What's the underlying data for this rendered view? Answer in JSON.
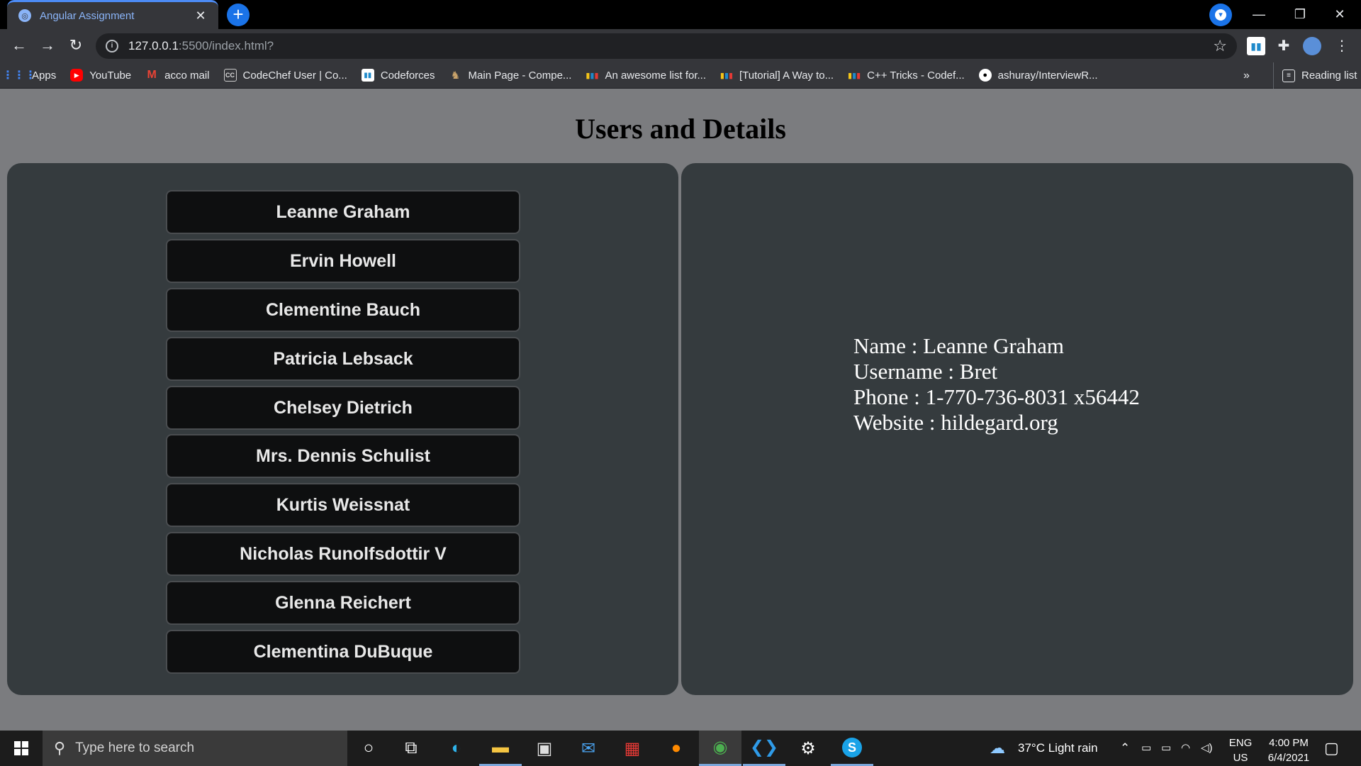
{
  "browser": {
    "tab_title": "Angular Assignment",
    "url_host": "127.0.0.1",
    "url_path": ":5500/index.html?",
    "bookmarks": [
      {
        "label": "Apps",
        "icon": "apps-grid-icon",
        "color": "#4285f4"
      },
      {
        "label": "YouTube",
        "icon": "youtube-icon",
        "color": "#ff0000"
      },
      {
        "label": "acco mail",
        "icon": "gmail-icon",
        "color": "#ea4335"
      },
      {
        "label": "CodeChef User | Co...",
        "icon": "codechef-icon",
        "color": "#ffffff"
      },
      {
        "label": "Codeforces",
        "icon": "codeforces-icon",
        "color": "#1f8acb"
      },
      {
        "label": "Main Page - Compe...",
        "icon": "wiki-icon",
        "color": "#c9a36b"
      },
      {
        "label": "An awesome list for...",
        "icon": "codeforces-icon",
        "color": "#1f8acb"
      },
      {
        "label": "[Tutorial] A Way to...",
        "icon": "codeforces-icon",
        "color": "#1f8acb"
      },
      {
        "label": "C++ Tricks - Codef...",
        "icon": "codeforces-icon",
        "color": "#1f8acb"
      },
      {
        "label": "ashuray/InterviewR...",
        "icon": "github-icon",
        "color": "#ffffff"
      }
    ],
    "reading_list": "Reading list"
  },
  "page": {
    "title": "Users and Details",
    "users": [
      "Leanne Graham",
      "Ervin Howell",
      "Clementine Bauch",
      "Patricia Lebsack",
      "Chelsey Dietrich",
      "Mrs. Dennis Schulist",
      "Kurtis Weissnat",
      "Nicholas Runolfsdottir V",
      "Glenna Reichert",
      "Clementina DuBuque"
    ],
    "details": {
      "name": "Name : Leanne Graham",
      "username": "Username : Bret",
      "phone": "Phone : 1-770-736-8031 x56442",
      "website": "Website : hildegard.org"
    }
  },
  "taskbar": {
    "search_placeholder": "Type here to search",
    "weather": "37°C  Light rain",
    "lang_top": "ENG",
    "lang_bottom": "US",
    "time": "4:00 PM",
    "date": "6/4/2021"
  },
  "colors": {
    "page_bg": "#7b7c7f",
    "panel_bg": "#353b3e",
    "button_bg": "#0e0f10",
    "tab_accent": "#4c8bf5"
  }
}
